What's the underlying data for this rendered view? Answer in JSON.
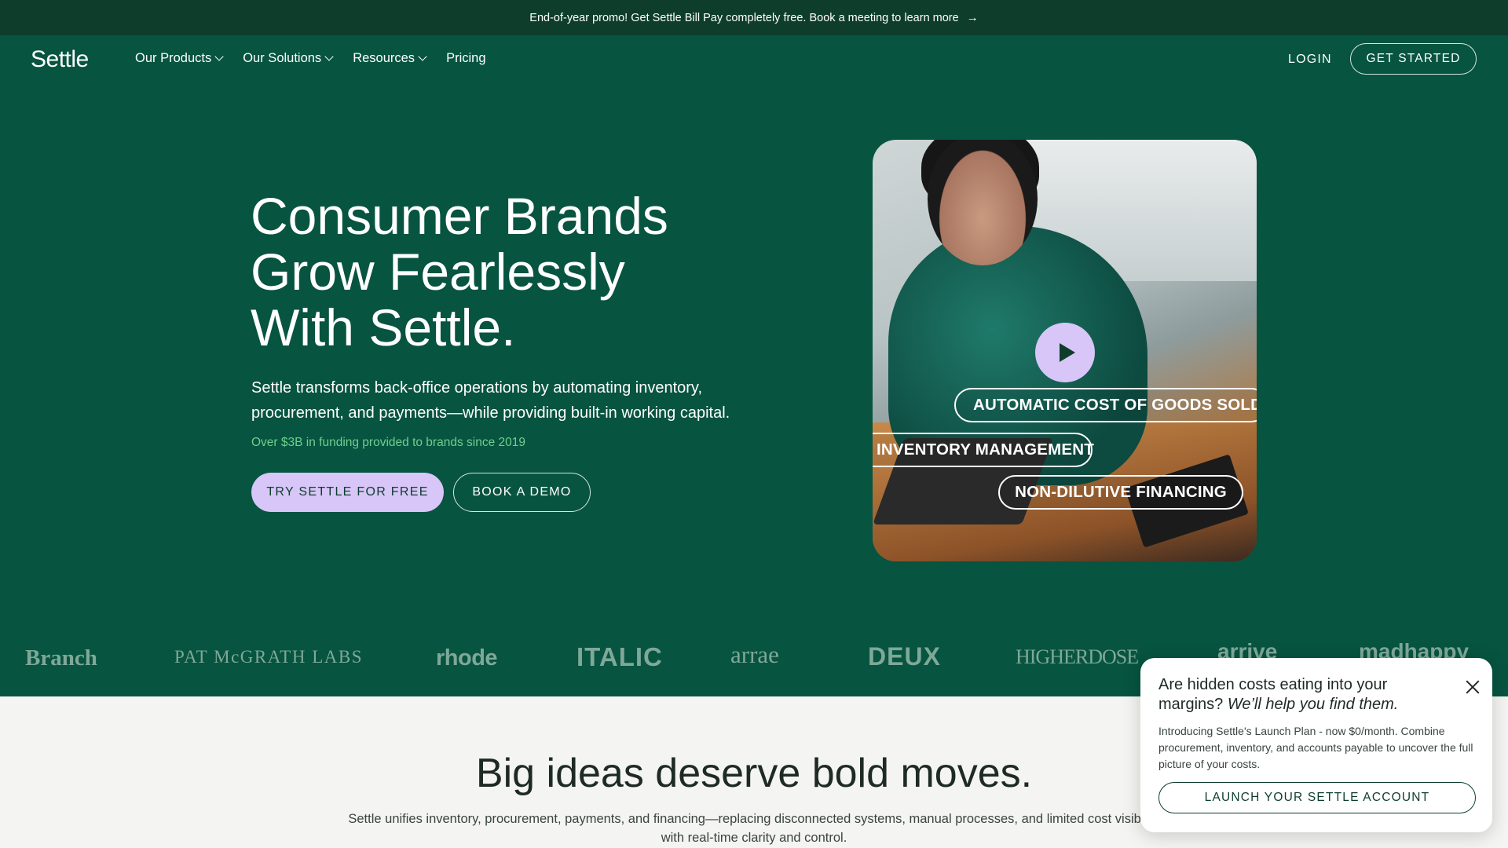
{
  "promo": {
    "text": "End-of-year promo! Get Settle Bill Pay completely free. Book a meeting to learn more",
    "arrow": "→"
  },
  "nav": {
    "logo": "Settle",
    "links": [
      {
        "label": "Our Products",
        "has_dropdown": true
      },
      {
        "label": "Our Solutions",
        "has_dropdown": true
      },
      {
        "label": "Resources",
        "has_dropdown": true
      },
      {
        "label": "Pricing",
        "has_dropdown": false
      }
    ],
    "login": "LOGIN",
    "get_started": "GET STARTED"
  },
  "hero": {
    "title_lines": [
      "Consumer Brands",
      "Grow Fearlessly",
      "With Settle."
    ],
    "subtitle": "Settle transforms back-office operations by automating inventory, procurement, and payments—while providing built-in working capital.",
    "funding": "Over $3B in funding provided to brands since 2019",
    "cta_primary": "TRY SETTLE FOR FREE",
    "cta_secondary": "BOOK A DEMO",
    "media": {
      "pills": [
        "AUTOMATIC COST OF GOODS SOLD",
        "INVENTORY MANAGEMENT",
        "NON-DILUTIVE FINANCING"
      ],
      "play_icon": "play-icon"
    }
  },
  "logos": [
    "Branch",
    "PAT McGRATH LABS",
    "rhode",
    "ITALIC",
    "arrae",
    "DEUX",
    "HIGHERDOSE",
    "arrive",
    "madhappy"
  ],
  "section": {
    "title": "Big ideas deserve bold moves.",
    "subtitle": "Settle unifies inventory, procurement, payments, and financing—replacing disconnected systems, manual processes, and limited cost visibility with real-time clarity and control."
  },
  "popup": {
    "title_plain": "Are hidden costs eating into your margins? ",
    "title_italic": "We’ll help you find them.",
    "body": "Introducing Settle's Launch Plan - now $0/month. Combine procurement, inventory, and accounts payable to uncover the full picture of your costs.",
    "button": "LAUNCH YOUR SETTLE ACCOUNT"
  },
  "colors": {
    "hero_green": "#075440",
    "promo_green": "#0e3d2c",
    "lavender": "#d7c6f7",
    "funding_green": "#6fcf8e"
  }
}
